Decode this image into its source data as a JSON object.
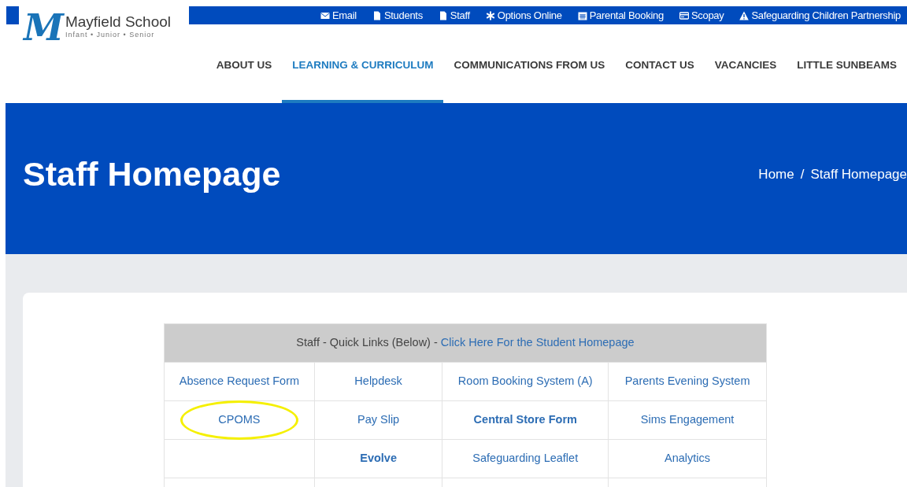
{
  "logo": {
    "monogram": "M",
    "name": "Mayfield School",
    "tagline": "Infant • Junior • Senior"
  },
  "top_links": [
    "Email",
    "Students",
    "Staff",
    "Options Online",
    "Parental Booking",
    "Scopay",
    "Safeguarding Children Partnership"
  ],
  "nav": [
    {
      "label": "ABOUT US",
      "selected": false
    },
    {
      "label": "LEARNING & CURRICULUM",
      "selected": true
    },
    {
      "label": "COMMUNICATIONS FROM US",
      "selected": false
    },
    {
      "label": "CONTACT US",
      "selected": false
    },
    {
      "label": "VACANCIES",
      "selected": false
    },
    {
      "label": "LITTLE SUNBEAMS",
      "selected": false
    }
  ],
  "hero": {
    "title": "Staff Homepage",
    "breadcrumb": [
      "Home",
      "Staff Homepage"
    ],
    "separator": "/"
  },
  "table": {
    "header": {
      "text": "Staff - Quick Links (Below) - ",
      "link": "Click Here For the Student Homepage"
    },
    "rows": [
      [
        {
          "label": "Absence Request Form",
          "bold": false,
          "highlighted": false
        },
        {
          "label": "Helpdesk",
          "bold": false,
          "highlighted": false
        },
        {
          "label": "Room Booking System (A)",
          "bold": false,
          "highlighted": false
        },
        {
          "label": "Parents Evening System",
          "bold": false,
          "highlighted": false
        }
      ],
      [
        {
          "label": "CPOMS",
          "bold": false,
          "highlighted": true
        },
        {
          "label": "Pay Slip",
          "bold": false,
          "highlighted": false
        },
        {
          "label": "Central Store Form",
          "bold": true,
          "highlighted": false
        },
        {
          "label": "Sims Engagement",
          "bold": false,
          "highlighted": false
        }
      ],
      [
        null,
        {
          "label": "Evolve",
          "bold": true,
          "highlighted": false
        },
        {
          "label": "Safeguarding Leaflet",
          "bold": false,
          "highlighted": false
        },
        {
          "label": "Analytics",
          "bold": false,
          "highlighted": false
        }
      ]
    ]
  }
}
